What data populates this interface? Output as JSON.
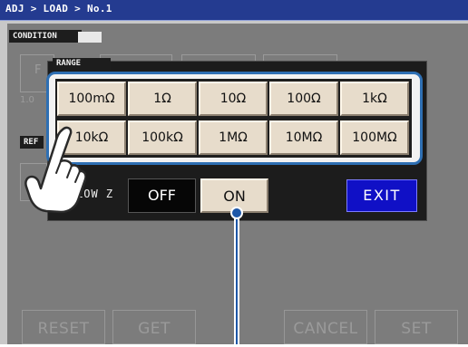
{
  "breadcrumb": "ADJ > LOAD > No.1",
  "condition_tab": "CONDITION",
  "ref_tab": "REF",
  "ghost": {
    "f_letter": "F",
    "value_prefix": "1.0"
  },
  "range_dialog": {
    "title": "RANGE",
    "buttons": [
      [
        "100mΩ",
        "1Ω",
        "10Ω",
        "100Ω",
        "1kΩ"
      ],
      [
        "10kΩ",
        "100kΩ",
        "1MΩ",
        "10MΩ",
        "100MΩ"
      ]
    ],
    "low_z_label": "LOW Z",
    "off_label": "OFF",
    "on_label": "ON",
    "exit_label": "EXIT"
  },
  "bottom_buttons": {
    "reset": "RESET",
    "get": "GET",
    "cancel": "CANCEL",
    "set": "SET"
  },
  "colors": {
    "title_bar": "#243b90",
    "range_frame": "#2e6fb3",
    "button_face": "#e7dccb",
    "exit_button": "#1010c6",
    "callout": "#1d57a8"
  },
  "icons": [
    "pointing-hand-icon",
    "callout-dot-icon"
  ]
}
